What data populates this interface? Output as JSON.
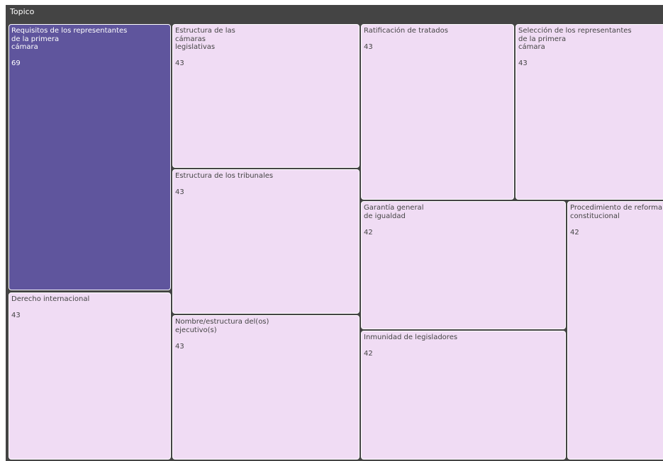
{
  "chart_data": {
    "type": "treemap",
    "title": "Topico",
    "colors": {
      "max": "#5f559d",
      "default": "#f0dcf4",
      "text_dark": "#444444",
      "text_light": "#ffffff",
      "background": "#444444"
    },
    "items": [
      {
        "label": "Requisitos de los representantes\nde la primera\ncámara",
        "value": 69
      },
      {
        "label": "Derecho internacional",
        "value": 43
      },
      {
        "label": "Estructura de las\ncámaras\nlegislativas",
        "value": 43
      },
      {
        "label": "Estructura de los tribunales",
        "value": 43
      },
      {
        "label": "Nombre/estructura del(os)\nejecutivo(s)",
        "value": 43
      },
      {
        "label": "Ratificación de tratados",
        "value": 43
      },
      {
        "label": "Selección de los representantes\nde la primera\ncámara",
        "value": 43
      },
      {
        "label": "Garantía general\nde igualdad",
        "value": 42
      },
      {
        "label": "Inmunidad de legisladores",
        "value": 42
      },
      {
        "label": "Procedimiento de reforma\nconstitucional",
        "value": 42
      }
    ]
  }
}
